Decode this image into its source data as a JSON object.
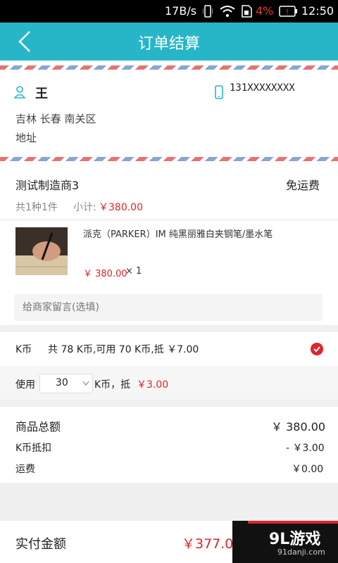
{
  "status_bar": {
    "speed": "17B/s",
    "battery": "4%",
    "time": "12:50"
  },
  "header": {
    "title": "订单结算"
  },
  "address": {
    "name": "王",
    "phone": "131XXXXXXXX",
    "region": "吉林 长春 南关区",
    "detail": "地址"
  },
  "store": {
    "name": "测试制造商3",
    "shipping": "免运费",
    "count_text": "共1种1件",
    "subtotal_label": "小计:",
    "subtotal": "￥380.00"
  },
  "product": {
    "name": "派克（PARKER）IM 纯黑丽雅白夹钢笔/墨水笔",
    "price": "￥ 380.00",
    "qty": "× 1"
  },
  "message": {
    "placeholder": "给商家留言(选填)"
  },
  "kcoin": {
    "label": "K币",
    "summary": "共 78 K币,可用 70 K币,抵 ￥7.00",
    "use_label": "使用",
    "use_value": "30",
    "unit_label": "K币，抵",
    "deduct": "￥3.00"
  },
  "totals": {
    "goods_label": "商品总额",
    "goods_value": "￥ 380.00",
    "kcoin_label": "K币抵扣",
    "kcoin_value": "- ￥3.00",
    "shipping_label": "运费",
    "shipping_value": "￥0.00"
  },
  "footer": {
    "pay_label": "实付金额",
    "pay_value": "￥377.00"
  },
  "watermark": {
    "brand": "9L游戏",
    "site": "91danji.com"
  },
  "colors": {
    "accent": "#27b6c8",
    "price": "#e0242a"
  }
}
